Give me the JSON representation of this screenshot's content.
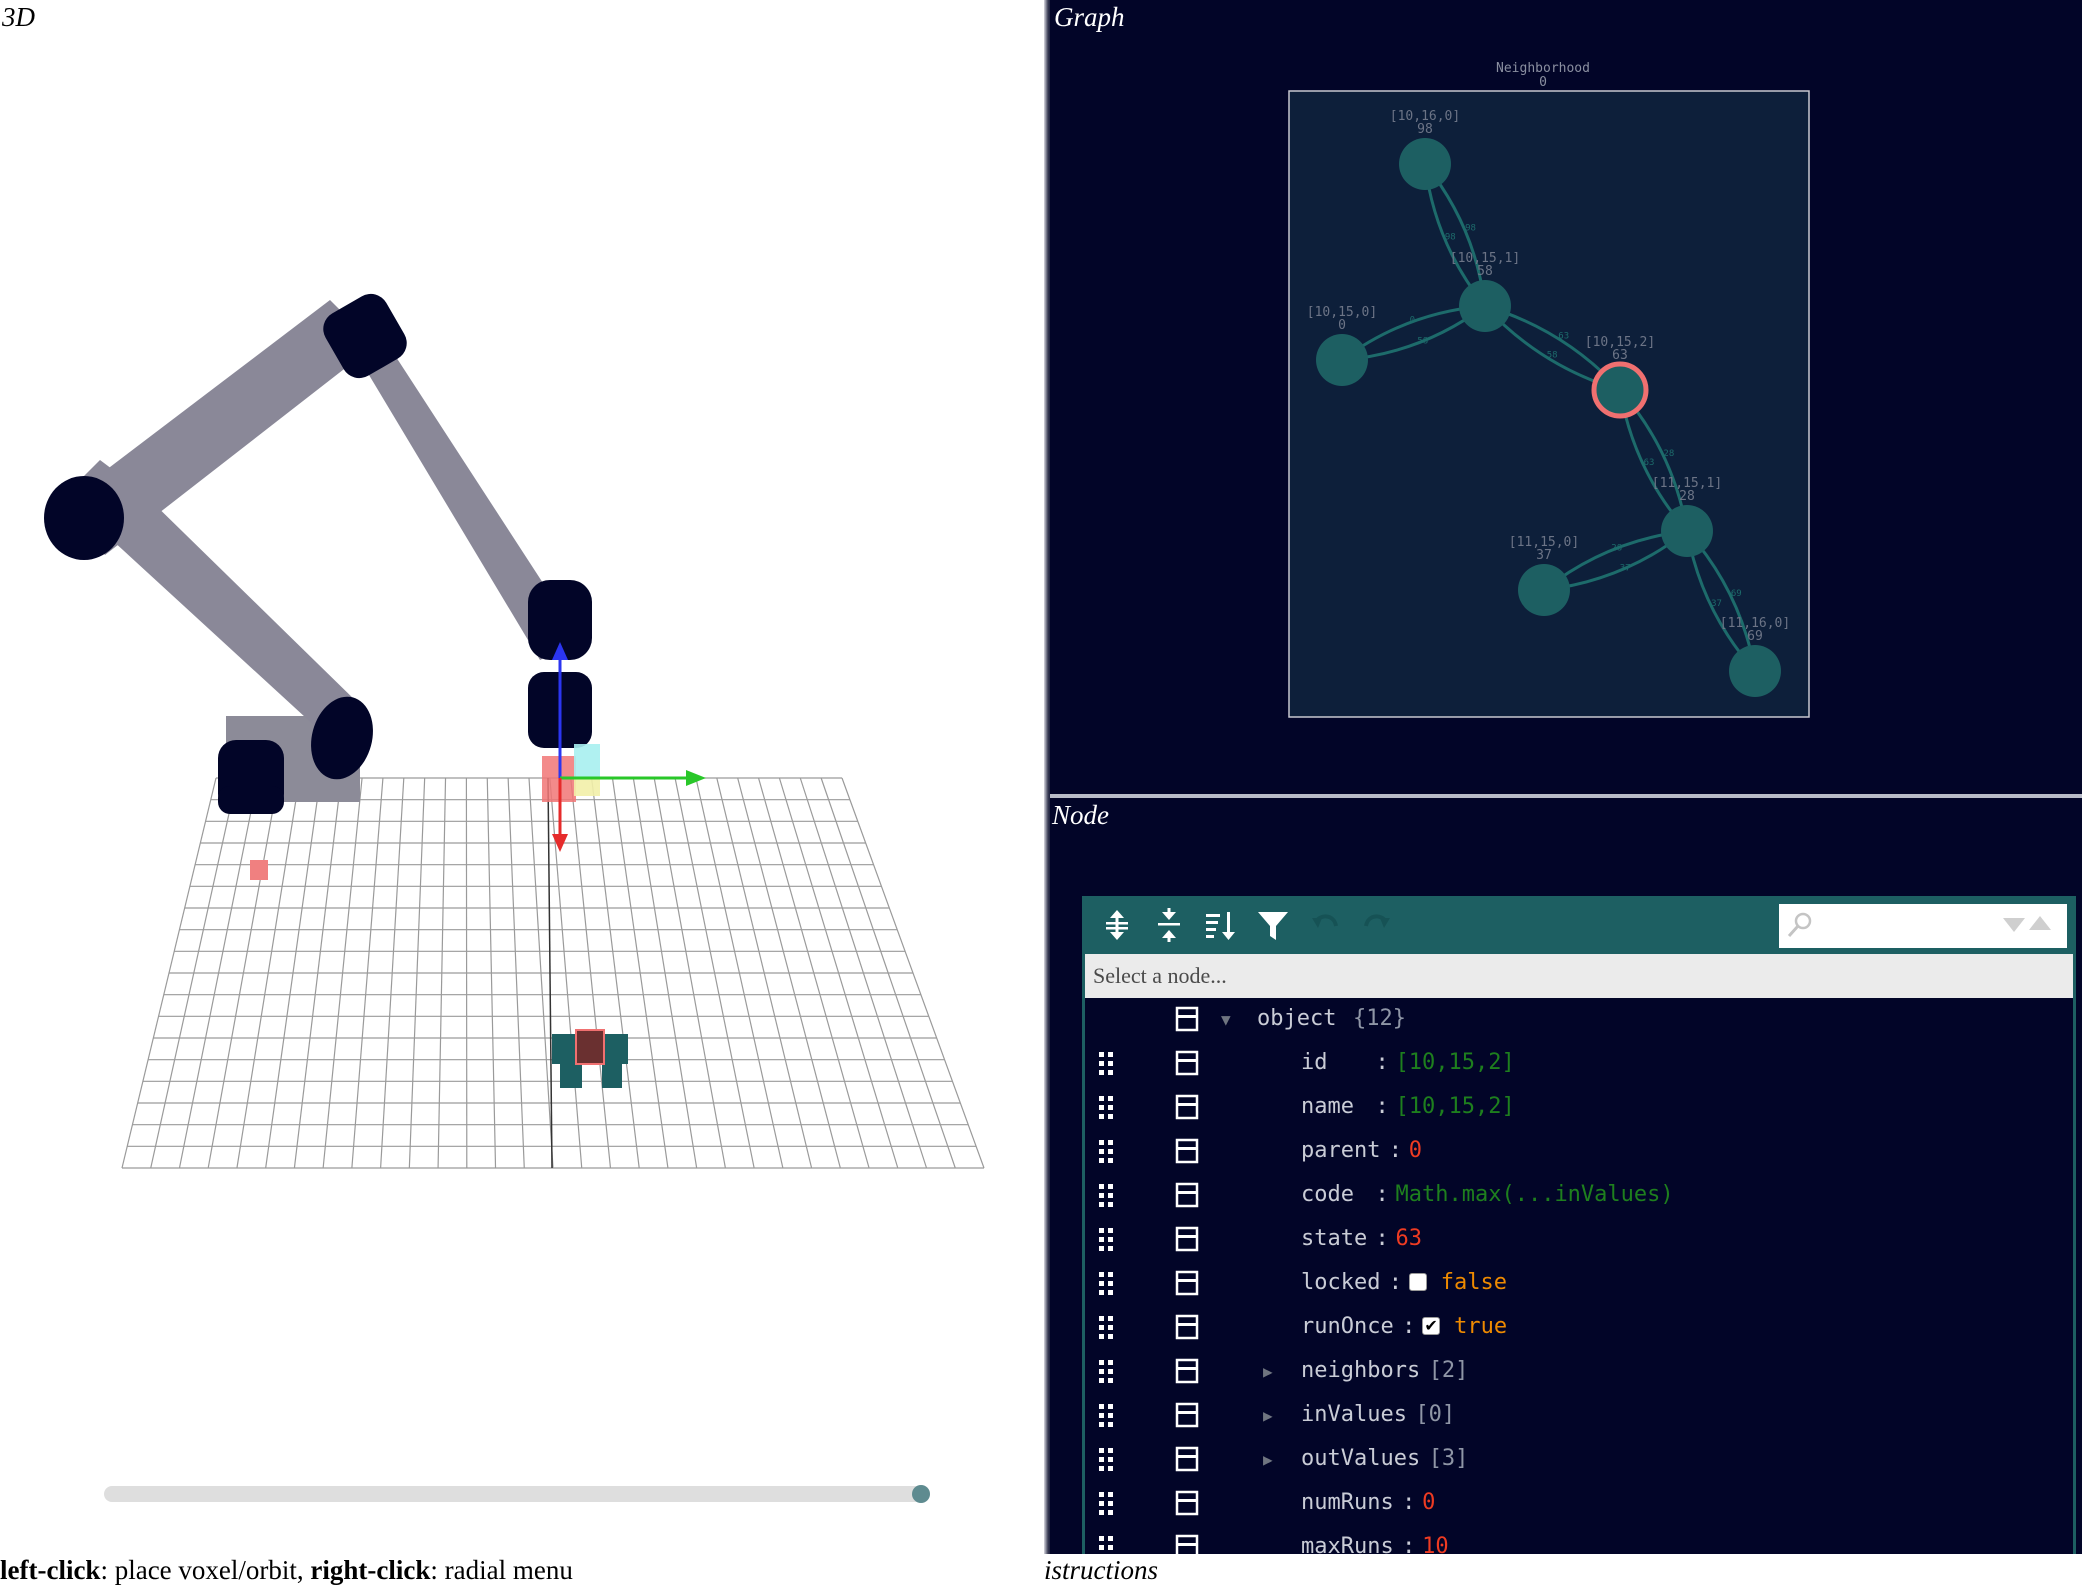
{
  "panels": {
    "viewport_title": "3D",
    "graph_title": "Graph",
    "node_title": "Node",
    "footer_left_1": "left-click",
    "footer_left_2": ": place voxel/orbit, ",
    "footer_left_3": "right-click",
    "footer_left_4": ": radial menu",
    "footer_right": "istructions"
  },
  "timeline": {
    "progress": 1.0
  },
  "graph": {
    "title": "Neighborhood",
    "subtitle": "0",
    "nodes": [
      {
        "label": "[10,16,0]",
        "value": "98"
      },
      {
        "label": "[10,15,1]",
        "value": "58"
      },
      {
        "label": "[10,15,0]",
        "value": "0"
      },
      {
        "label": "[10,15,2]",
        "value": "63"
      },
      {
        "label": "[11,15,1]",
        "value": "28"
      },
      {
        "label": "[11,15,0]",
        "value": "37"
      },
      {
        "label": "[11,16,0]",
        "value": "69"
      }
    ],
    "edge_labels": [
      "98",
      "98",
      "0",
      "58",
      "58",
      "63",
      "63",
      "28",
      "28",
      "37",
      "37",
      "69",
      "69"
    ],
    "colors": {
      "background": "#020528",
      "frame": "#0d1f3a",
      "node": "#1d5f62",
      "selected": "#f07070"
    }
  },
  "editor": {
    "search_placeholder": "",
    "nav_text": "Select a node...",
    "root_label": "object",
    "root_count": "{12}",
    "rows": [
      {
        "field": "id",
        "pad": "   ",
        "sep": ":",
        "value": "[10,15,2]",
        "kind": "str"
      },
      {
        "field": "name",
        "pad": " ",
        "sep": ":",
        "value": "[10,15,2]",
        "kind": "str"
      },
      {
        "field": "parent",
        "pad": "",
        "sep": ":",
        "value": "0",
        "kind": "num"
      },
      {
        "field": "code",
        "pad": " ",
        "sep": ":",
        "value": "Math.max(...inValues)",
        "kind": "str"
      },
      {
        "field": "state",
        "pad": "",
        "sep": ":",
        "value": "63",
        "kind": "num"
      },
      {
        "field": "locked",
        "pad": "",
        "sep": ":",
        "value": "false",
        "kind": "bool",
        "checkbox": ""
      },
      {
        "field": "runOnce",
        "pad": "",
        "sep": ":",
        "value": "true",
        "kind": "bool",
        "checkbox": "✔"
      },
      {
        "field": "neighbors",
        "pad": "",
        "sep": "",
        "value": "[2]",
        "kind": "cnt",
        "expand": "▶"
      },
      {
        "field": "inValues",
        "pad": "",
        "sep": "",
        "value": "[0]",
        "kind": "cnt",
        "expand": "▶"
      },
      {
        "field": "outValues",
        "pad": "",
        "sep": "",
        "value": "[3]",
        "kind": "cnt",
        "expand": "▶"
      },
      {
        "field": "numRuns",
        "pad": "",
        "sep": ":",
        "value": "0",
        "kind": "num"
      },
      {
        "field": "maxRuns",
        "pad": "",
        "sep": ":",
        "value": "10",
        "kind": "num"
      }
    ]
  }
}
